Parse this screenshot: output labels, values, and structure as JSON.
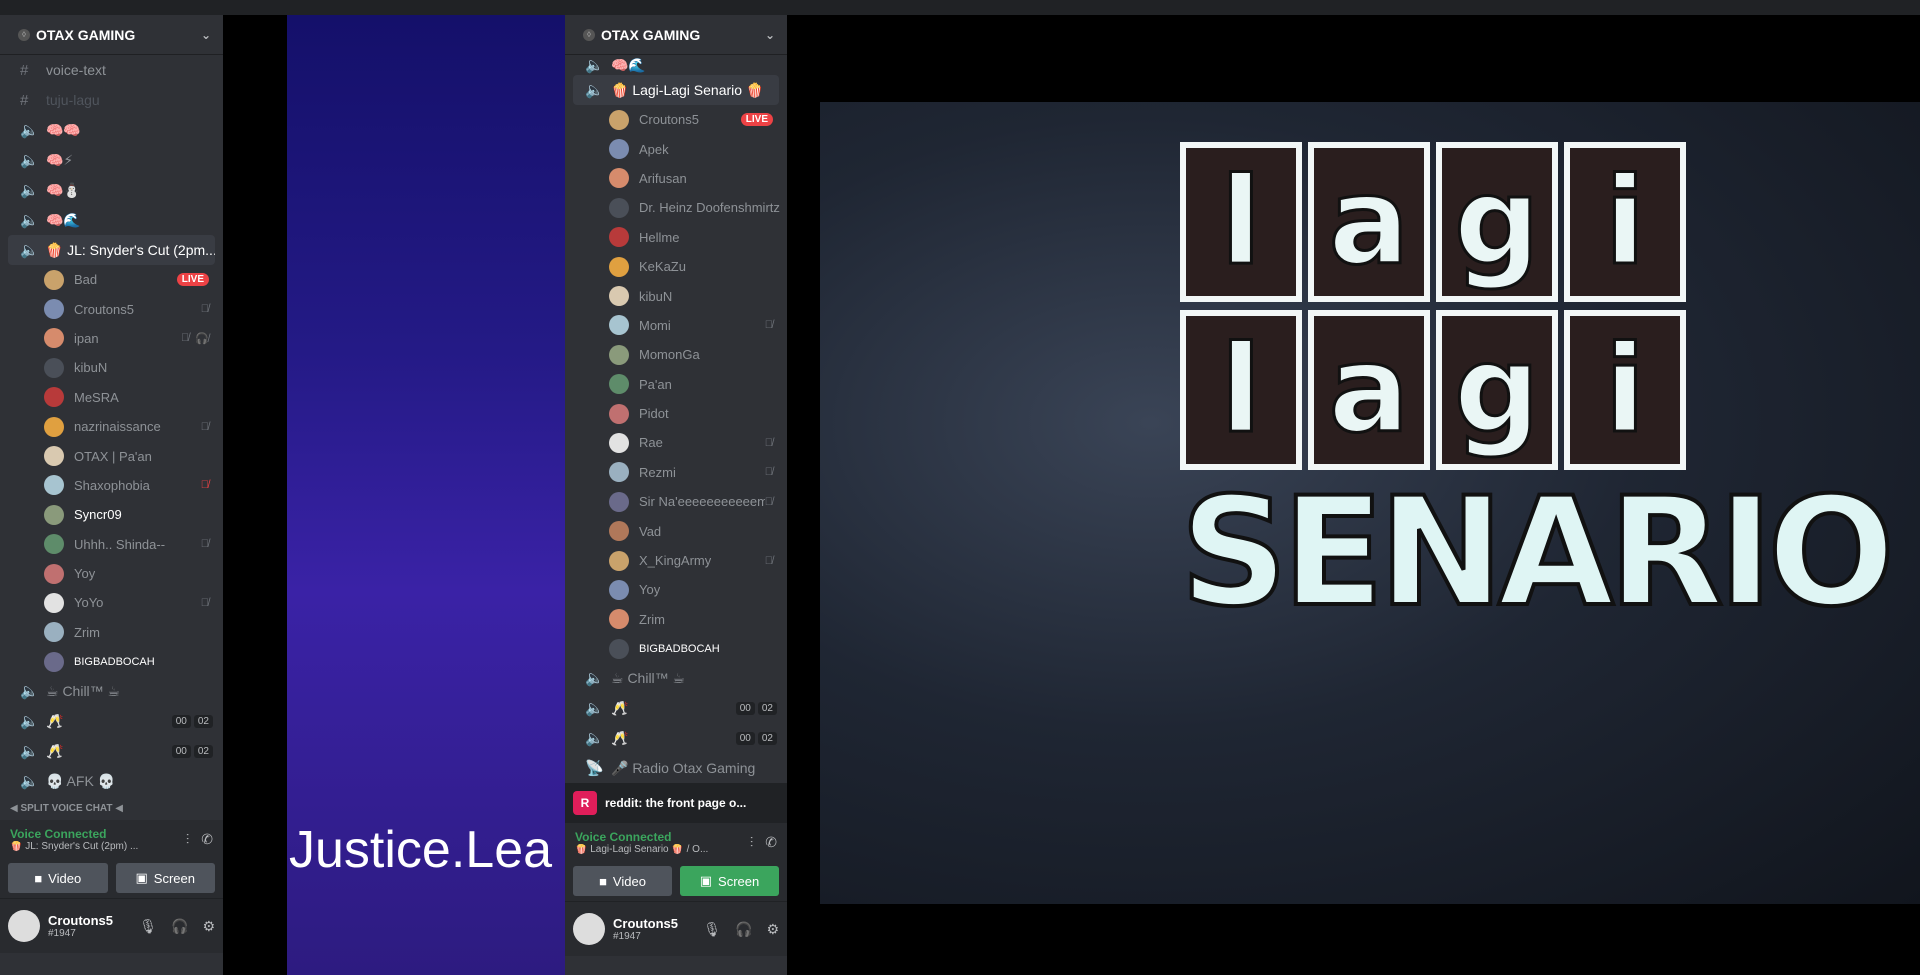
{
  "left": {
    "server": "OTAX GAMING",
    "channels": [
      {
        "type": "text",
        "name": "voice-text"
      },
      {
        "type": "text",
        "name": "tuju-lagu",
        "dim": true
      },
      {
        "type": "voice",
        "name": "🧠🧠"
      },
      {
        "type": "voice",
        "name": "🧠⚡"
      },
      {
        "type": "voice",
        "name": "🧠⛄"
      },
      {
        "type": "voice",
        "name": "🧠🌊"
      }
    ],
    "active_channel": "🍿 JL: Snyder's Cut (2pm...",
    "members": [
      {
        "name": "Bad",
        "live": true
      },
      {
        "name": "Croutons5",
        "muted": true
      },
      {
        "name": "ipan",
        "muted": true,
        "deafened": true
      },
      {
        "name": "kibuN"
      },
      {
        "name": "MeSRA"
      },
      {
        "name": "nazrinaissance",
        "muted": true
      },
      {
        "name": "OTAX | Pa'an"
      },
      {
        "name": "Shaxophobia",
        "muted_red": true
      },
      {
        "name": "Syncr09",
        "white": true
      },
      {
        "name": "Uhhh.. Shinda--",
        "muted": true
      },
      {
        "name": "Yoy"
      },
      {
        "name": "YoYo",
        "muted": true
      },
      {
        "name": "Zrim"
      },
      {
        "name": "BIGBADBOCAH",
        "white": true,
        "small": true
      }
    ],
    "after": [
      {
        "name": "☕ Chill™ ☕"
      },
      {
        "name": "🥂",
        "pills": [
          "00",
          "02"
        ]
      },
      {
        "name": "🥂",
        "pills": [
          "00",
          "02"
        ]
      },
      {
        "name": "💀 AFK 💀"
      }
    ],
    "category": "◀ SPLIT VOICE CHAT ◀",
    "voice": {
      "status": "Voice Connected",
      "channel": "🍿 JL: Snyder's Cut (2pm) ..."
    },
    "buttons": {
      "video": "Video",
      "screen": "Screen"
    },
    "user": {
      "name": "Croutons5",
      "tag": "#1947"
    }
  },
  "stream_a": {
    "caption": "Justice.Lea"
  },
  "right": {
    "server": "OTAX GAMING",
    "top_channel": "🧠🌊",
    "active_channel": "🍿 Lagi-Lagi Senario 🍿",
    "members": [
      {
        "name": "Croutons5",
        "live": true
      },
      {
        "name": "Apek"
      },
      {
        "name": "Arifusan"
      },
      {
        "name": "Dr. Heinz Doofenshmirtz"
      },
      {
        "name": "Hellme"
      },
      {
        "name": "KeKaZu"
      },
      {
        "name": "kibuN"
      },
      {
        "name": "Momi",
        "muted": true
      },
      {
        "name": "MomonGa"
      },
      {
        "name": "Pa'an"
      },
      {
        "name": "Pidot"
      },
      {
        "name": "Rae",
        "muted": true
      },
      {
        "name": "Rezmi",
        "muted": true
      },
      {
        "name": "Sir Na'eeeeeeeeeeem",
        "muted": true
      },
      {
        "name": "Vad"
      },
      {
        "name": "X_KingArmy",
        "muted": true
      },
      {
        "name": "Yoy"
      },
      {
        "name": "Zrim"
      },
      {
        "name": "BIGBADBOCAH",
        "white": true,
        "small": true
      }
    ],
    "after": [
      {
        "name": "☕ Chill™ ☕"
      },
      {
        "name": "🥂",
        "pills": [
          "00",
          "02"
        ]
      },
      {
        "name": "🥂",
        "pills": [
          "00",
          "02"
        ]
      },
      {
        "name": "🎤 Radio Otax Gaming",
        "stage": true
      }
    ],
    "activity": {
      "name": "reddit: the front page o..."
    },
    "voice": {
      "status": "Voice Connected",
      "channel": "🍿 Lagi-Lagi Senario 🍿 / O..."
    },
    "buttons": {
      "video": "Video",
      "screen": "Screen"
    },
    "user": {
      "name": "Croutons5",
      "tag": "#1947"
    }
  },
  "stream_b": {
    "row1": [
      "l",
      "a",
      "g",
      "i"
    ],
    "row2": [
      "l",
      "a",
      "g",
      "i"
    ],
    "word": "SENARIO"
  },
  "colors": {
    "live": "#ed4245",
    "connected": "#3ba55d",
    "panel": "#2f3136"
  }
}
